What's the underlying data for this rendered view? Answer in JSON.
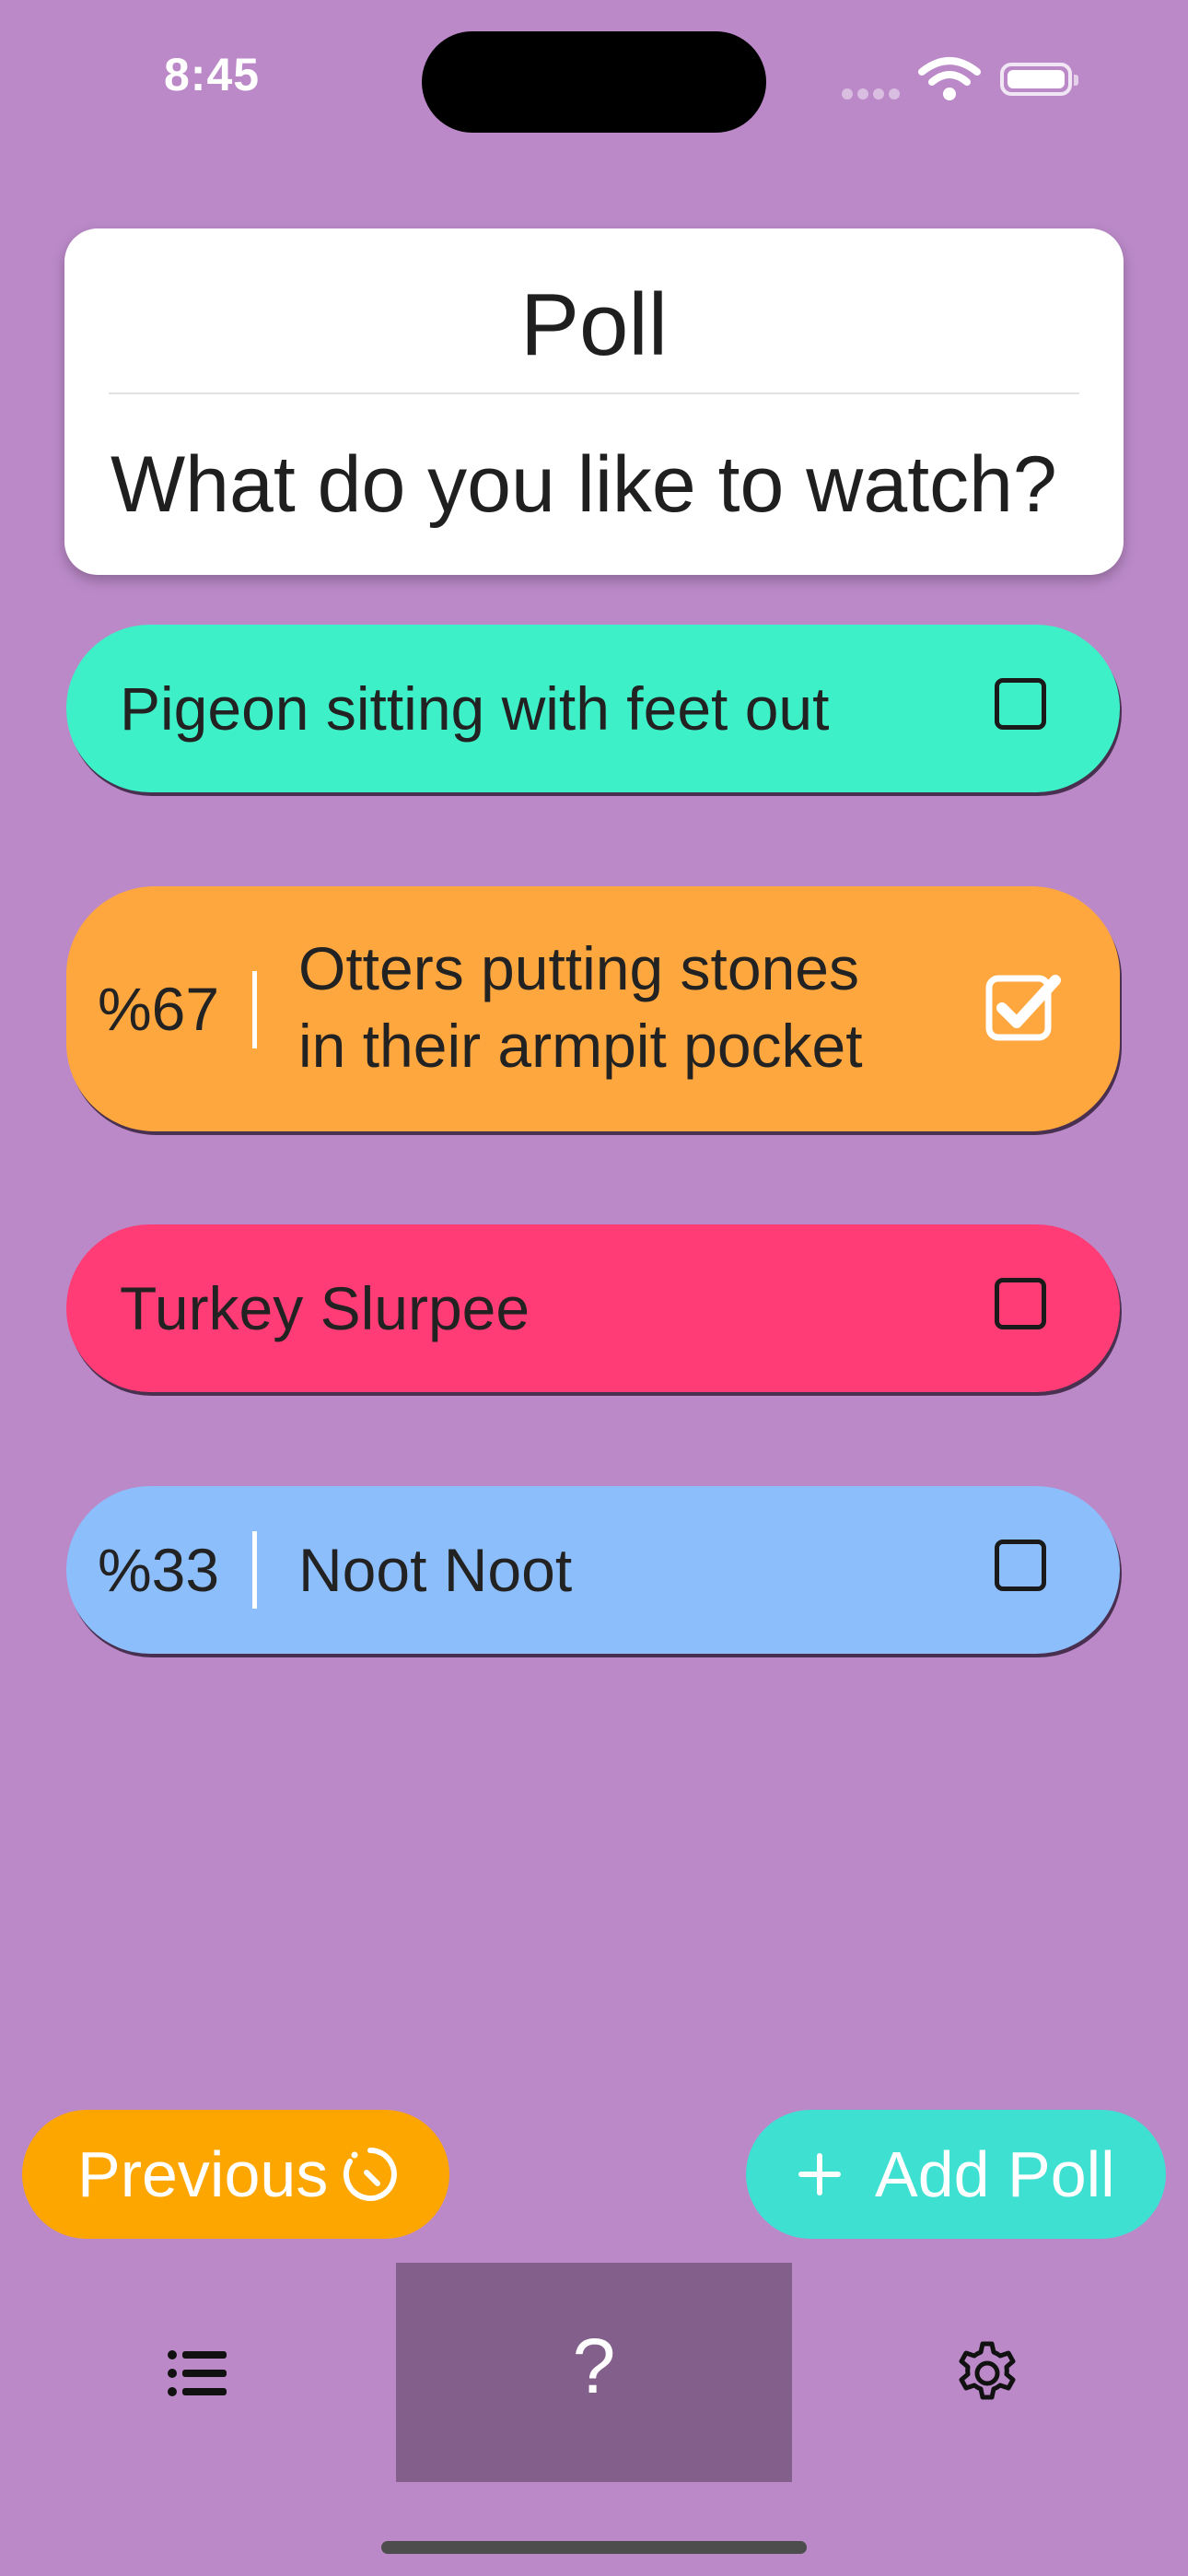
{
  "status_bar": {
    "time": "8:45"
  },
  "poll": {
    "title": "Poll",
    "question": "What do you like to watch?"
  },
  "options": [
    {
      "label": "Pigeon sitting with feet out",
      "percent": "",
      "checked": false,
      "color": "#3ef0c8"
    },
    {
      "label_line1": "Otters putting stones",
      "label_line2": "in their armpit pocket",
      "percent": "%67",
      "checked": true,
      "color": "#fea73f"
    },
    {
      "label": "Turkey Slurpee",
      "percent": "",
      "checked": false,
      "color": "#ff3c75"
    },
    {
      "label": "Noot Noot",
      "percent": "%33",
      "checked": false,
      "color": "#8dbefc"
    }
  ],
  "actions": {
    "previous_label": "Previous",
    "previous_color": "#fea600",
    "add_label": "Add Poll",
    "add_color": "#3ee0d2"
  },
  "tab_bar": {
    "tabs": [
      {
        "icon": "list-icon",
        "active": false
      },
      {
        "icon": "question-icon",
        "label": "?",
        "active": true
      },
      {
        "icon": "gear-icon",
        "active": false
      }
    ],
    "active_color": "#83608c"
  },
  "theme": {
    "background": "#bb89c8"
  }
}
